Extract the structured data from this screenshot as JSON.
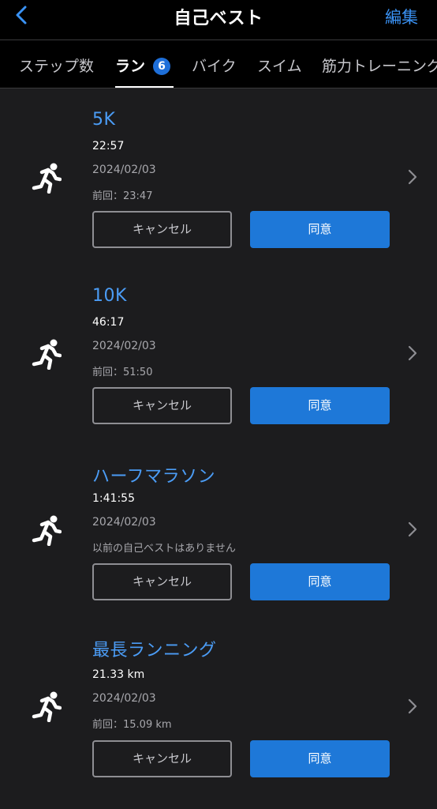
{
  "header": {
    "title": "自己ベスト",
    "edit_label": "編集"
  },
  "tabs": [
    {
      "label": "ステップ数"
    },
    {
      "label": "ラン",
      "badge": "6"
    },
    {
      "label": "バイク"
    },
    {
      "label": "スイム"
    },
    {
      "label": "筋力トレーニング"
    }
  ],
  "records": [
    {
      "name": "5K",
      "value": "22:57",
      "date": "2024/02/03",
      "previous": "前回：23:47",
      "cancel_label": "キャンセル",
      "agree_label": "同意"
    },
    {
      "name": "10K",
      "value": "46:17",
      "date": "2024/02/03",
      "previous": "前回：51:50",
      "cancel_label": "キャンセル",
      "agree_label": "同意"
    },
    {
      "name": "ハーフマラソン",
      "value": "1:41:55",
      "date": "2024/02/03",
      "previous": "以前の自己ベストはありません",
      "cancel_label": "キャンセル",
      "agree_label": "同意"
    },
    {
      "name": "最長ランニング",
      "value": "21.33 km",
      "date": "2024/02/03",
      "previous": "前回：15.09 km",
      "cancel_label": "キャンセル",
      "agree_label": "同意"
    }
  ],
  "colors": {
    "accent": "#3a92f4",
    "button_primary": "#1e78d8",
    "background": "#1c1c1e",
    "bar": "#000000"
  },
  "icons": {
    "back": "chevron-left-icon",
    "run": "running-person-icon",
    "row": "chevron-right-icon"
  }
}
